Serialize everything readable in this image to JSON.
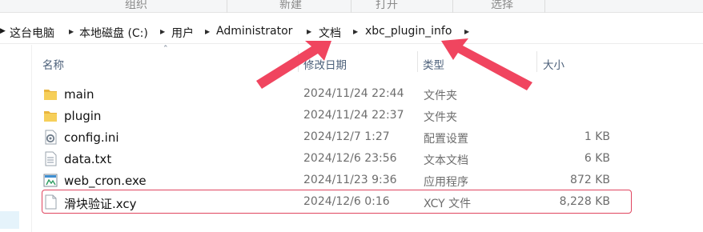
{
  "ribbon": {
    "groups": [
      "组织",
      "新建",
      "打开",
      "选择"
    ]
  },
  "breadcrumb": {
    "items": [
      "这台电脑",
      "本地磁盘 (C:)",
      "用户",
      "Administrator",
      "文档",
      "xbc_plugin_info"
    ]
  },
  "columns": {
    "name": "名称",
    "modified": "修改日期",
    "type": "类型",
    "size": "大小"
  },
  "files": [
    {
      "name": "main",
      "modified": "2024/11/24 22:44",
      "type": "文件夹",
      "size": "",
      "icon": "folder-icon"
    },
    {
      "name": "plugin",
      "modified": "2024/11/24 22:37",
      "type": "文件夹",
      "size": "",
      "icon": "folder-icon"
    },
    {
      "name": "config.ini",
      "modified": "2024/12/7 1:27",
      "type": "配置设置",
      "size": "1 KB",
      "icon": "settings-file-icon"
    },
    {
      "name": "data.txt",
      "modified": "2024/12/6 23:56",
      "type": "文本文档",
      "size": "6 KB",
      "icon": "text-file-icon"
    },
    {
      "name": "web_cron.exe",
      "modified": "2024/11/23 9:36",
      "type": "应用程序",
      "size": "872 KB",
      "icon": "application-icon"
    },
    {
      "name": "滑块验证.xcy",
      "modified": "2024/12/6 0:16",
      "type": "XCY 文件",
      "size": "8,228 KB",
      "icon": "blank-file-icon",
      "highlighted": true
    }
  ],
  "colors": {
    "annotation": "#f0455f",
    "highlight_border": "#e0455f",
    "folder": "#f2c14a",
    "header_text": "#4c607a"
  }
}
